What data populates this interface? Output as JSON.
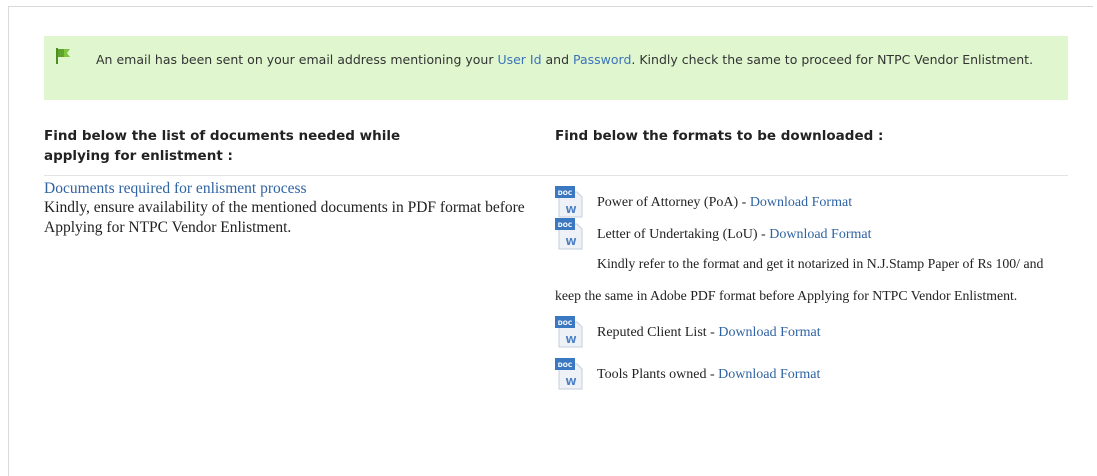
{
  "alert": {
    "text_before": "An email has been sent on your email address mentioning your ",
    "user_id_link": "User Id",
    "text_and": " and ",
    "password_link": "Password",
    "text_after": ". Kindly check the same to proceed for NTPC Vendor Enlistment.",
    "background": "#dff6cf"
  },
  "left": {
    "heading": "Find below the list of documents needed while applying for enlistment :",
    "doc_link": "Documents required for enlisment process",
    "note": "Kindly, ensure availability of the mentioned documents in PDF format before Applying for NTPC Vendor Enlistment."
  },
  "right": {
    "heading": "Find below the formats to be downloaded :",
    "items": [
      {
        "label": "Power of Attorney (PoA) - ",
        "link": "Download Format"
      },
      {
        "label": "Letter of Undertaking (LoU) - ",
        "link": "Download Format"
      },
      {
        "label": "Reputed Client List - ",
        "link": "Download Format"
      },
      {
        "label": "Tools Plants owned - ",
        "link": "Download Format"
      }
    ],
    "notary_note": "Kindly refer to the format and get it notarized in N.J.Stamp Paper of Rs 100/ and keep the same in Adobe PDF format before Applying for NTPC Vendor Enlistment."
  },
  "colors": {
    "link": "#2f63a3",
    "alert_link": "#3b73b9"
  },
  "icons": {
    "alert": "flag-icon",
    "download": "word-document-icon"
  }
}
